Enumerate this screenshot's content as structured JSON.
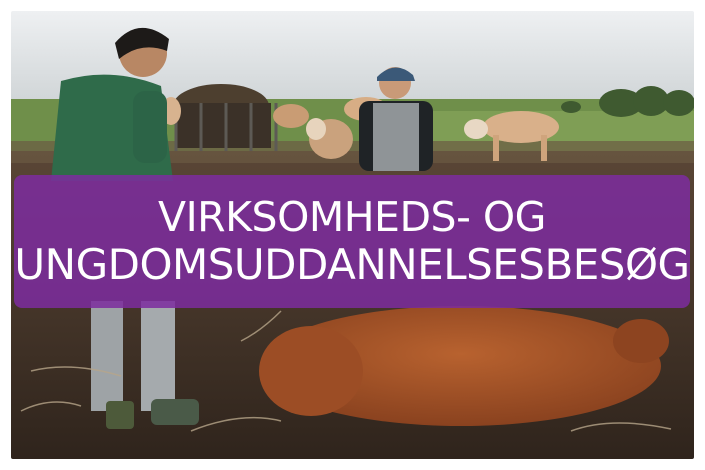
{
  "banner": {
    "line1": "VIRKSOMHEDS- OG",
    "line2": "UNGDOMSUDDANNELSESBESØG"
  },
  "photo": {
    "subjects": [
      "young-man-green-shirt",
      "boy-cap-tshirt",
      "cattle-herd",
      "lying-brown-cow",
      "hay-feeder"
    ]
  },
  "colors": {
    "banner": "#7d2c9e",
    "banner_text": "#ffffff",
    "sky": "#d9dde0",
    "field": "#6f8f4a",
    "ground": "#4a3a2c",
    "cow_brown": "#a9562c"
  }
}
